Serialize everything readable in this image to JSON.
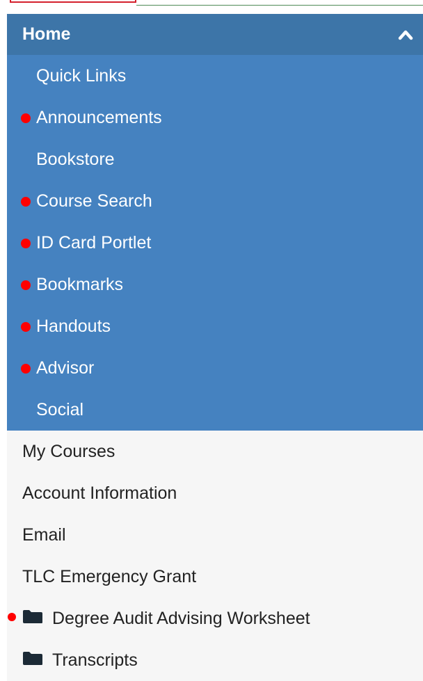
{
  "home": {
    "label": "Home"
  },
  "submenu": [
    {
      "label": "Quick Links",
      "dot": false
    },
    {
      "label": "Announcements",
      "dot": true
    },
    {
      "label": "Bookstore",
      "dot": false
    },
    {
      "label": "Course Search",
      "dot": true
    },
    {
      "label": "ID Card Portlet",
      "dot": true
    },
    {
      "label": "Bookmarks",
      "dot": true
    },
    {
      "label": "Handouts",
      "dot": true
    },
    {
      "label": "Advisor",
      "dot": true
    },
    {
      "label": "Social",
      "dot": false
    }
  ],
  "main": [
    {
      "label": "My Courses"
    },
    {
      "label": "Account Information"
    },
    {
      "label": "Email"
    },
    {
      "label": "TLC Emergency Grant"
    },
    {
      "label": "Degree Audit Advising Worksheet",
      "icon": "folder-icon",
      "dot": true
    },
    {
      "label": "Transcripts",
      "icon": "folder-icon",
      "dot": false
    }
  ],
  "colors": {
    "header": "#3d75a8",
    "submenu": "#4582c0",
    "notification_dot": "#ff0000",
    "main_bg": "#f6f6f6"
  }
}
